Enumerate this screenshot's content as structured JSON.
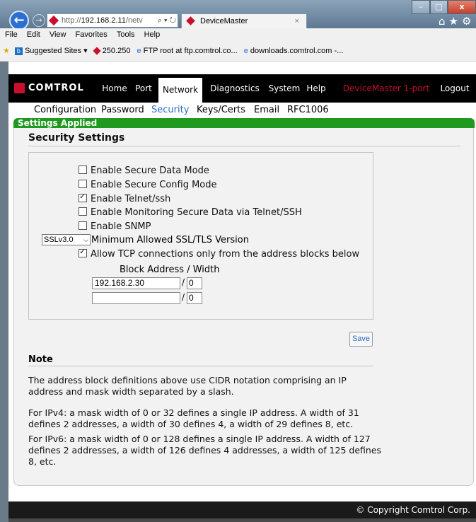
{
  "browser": {
    "url_prefix": "http://",
    "url_host": "192.168.2.11",
    "url_rest": "/netv",
    "url_tools": "⌕ ▾ ↻",
    "tab_title": "DeviceMaster",
    "tab_close": "×",
    "back": "←",
    "forward": "→",
    "window_min": "–",
    "window_max": "□",
    "window_close": "x",
    "toolbar_icons": "⌂★⚙",
    "menu": [
      "File",
      "Edit",
      "View",
      "Favorites",
      "Tools",
      "Help"
    ],
    "favorites": {
      "suggested": "Suggested Sites ▾",
      "ip": "250.250",
      "ftp": "FTP root at ftp.comtrol.co...",
      "downloads": "downloads.comtrol.com -..."
    }
  },
  "nav": {
    "logo": "COMTROL",
    "items": [
      "Home",
      "Port",
      "Network",
      "Diagnostics",
      "System",
      "Help"
    ],
    "active": "Network",
    "device": "DeviceMaster 1-port",
    "logout": "Logout"
  },
  "subnav": {
    "items": [
      "Configuration",
      "Password",
      "Security",
      "Keys/Certs",
      "Email",
      "RFC1006"
    ],
    "active": "Security"
  },
  "banner": "Settings Applied",
  "section": {
    "title": "Security Settings",
    "options": [
      {
        "label": "Enable Secure Data Mode",
        "checked": false
      },
      {
        "label": "Enable Secure Config Mode",
        "checked": false
      },
      {
        "label": "Enable Telnet/ssh",
        "checked": true
      },
      {
        "label": "Enable Monitoring Secure Data via Telnet/SSH",
        "checked": false
      },
      {
        "label": "Enable SNMP",
        "checked": false
      }
    ],
    "ssl_select_value": "SSLv3.0",
    "ssl_select_label": "Minimum Allowed SSL/TLS Version",
    "allow_tcp": {
      "label": "Allow TCP connections only from the address blocks below",
      "checked": true
    },
    "block_header": "Block Address / Width",
    "blocks": [
      {
        "address": "192.168.2.30",
        "width": "0"
      },
      {
        "address": "",
        "width": "0"
      }
    ],
    "slash": "/",
    "save": "Save"
  },
  "note": {
    "title": "Note",
    "paragraphs": [
      "The address block definitions above use CIDR notation comprising an IP address and mask width separated by a slash.",
      "For IPv4: a mask width of 0 or 32 defines a single IP address. A width of 31 defines 2 addresses, a width of 30 defines 4, a width of 29 defines 8, etc.",
      "For IPv6: a mask width of 0 or 128 defines a single IP address. A width of 127 defines 2 addresses, a width of 126 defines 4 addresses, a width of 125 defines 8, etc."
    ]
  },
  "footer": "© Copyright Comtrol Corp.",
  "colors": {
    "brand_red": "#c8102e",
    "banner_green": "#1f9a1f",
    "link_blue": "#2a6ec2",
    "nav_black": "#000000"
  }
}
